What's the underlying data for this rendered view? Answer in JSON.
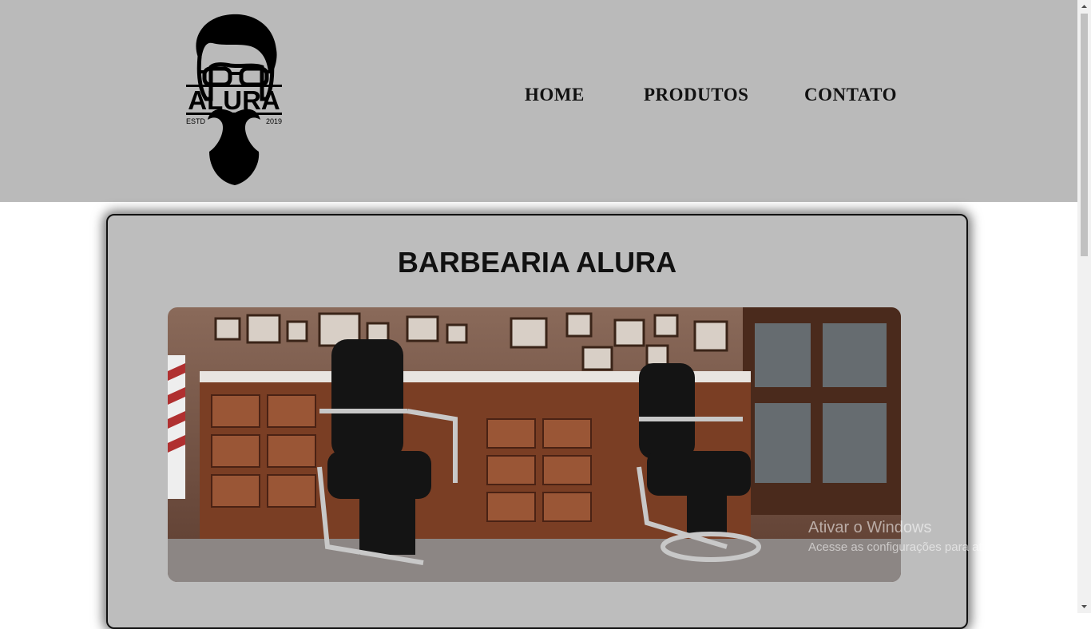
{
  "header": {
    "logo": {
      "brand_text": "ALURA",
      "estd_text": "ESTD",
      "year_text": "2019",
      "icon": "bearded-man-logo"
    },
    "nav": [
      {
        "label": "HOME"
      },
      {
        "label": "PRODUTOS"
      },
      {
        "label": "CONTATO"
      }
    ]
  },
  "main": {
    "title": "BARBEARIA ALURA",
    "image_icon": "barbershop-photo"
  },
  "watermark": {
    "line1": "Ativar o Windows",
    "line2": "Acesse as configurações para ativar o Windows."
  },
  "colors": {
    "header_bg": "#bababa",
    "card_bg": "#bdbdbd",
    "text": "#111111"
  }
}
